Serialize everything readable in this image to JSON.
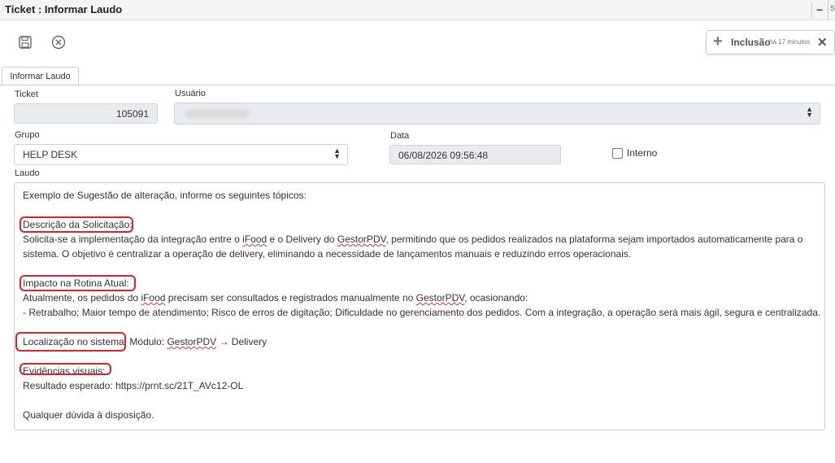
{
  "window": {
    "title": "Ticket : Informar Laudo",
    "minimize_label": "–",
    "edge_label": "S"
  },
  "toolbar": {
    "save_icon": "save-icon",
    "cancel_icon": "cancel-icon"
  },
  "notification": {
    "label": "Inclusão",
    "time": "há 17 minutos",
    "close": "✕",
    "plus": "+"
  },
  "tabs": [
    {
      "label": "Informar Laudo"
    }
  ],
  "form": {
    "ticket_label": "Ticket",
    "ticket_value": "105091",
    "usuario_label": "Usuário",
    "grupo_label": "Grupo",
    "grupo_value": "HELP DESK",
    "data_label": "Data",
    "data_value": "06/08/2026 09:56:48",
    "interno_label": "Interno",
    "interno_checked": false,
    "laudo_label": "Laudo"
  },
  "laudo": {
    "intro": "Exemplo de Sugestão de alteração, informe os seguintes tópicos:",
    "h1": "Descrição da Solicitação:",
    "p1a_1": "Solicita-se a implementação da integração entre o ",
    "p1a_ifood": "iFood",
    "p1a_2": " e o Delivery do ",
    "p1a_gestor": "GestorPDV",
    "p1a_3": ", permitindo que os pedidos realizados na plataforma sejam importados automaticamente para o",
    "p1b": "sistema. O objetivo é centralizar a operação de delivery, eliminando a necessidade de lançamentos manuais e reduzindo erros operacionais.",
    "h2": "Impacto na Rotina Atual:",
    "p2a_1": "Atualmente, os pedidos do ",
    "p2a_ifood": "iFood",
    "p2a_2": " precisam ser consultados e registrados manualmente no ",
    "p2a_gestor": "GestorPDV",
    "p2a_3": ", ocasionando:",
    "p2b": "- Retrabalho; Maior tempo de atendimento; Risco de erros de digitação; Dificuldade no gerenciamento dos pedidos. Com a integração, a operação será mais ágil, segura e centralizada.",
    "h3": "Localização no sistema:",
    "p3_1": " Módulo: ",
    "p3_gestor": "GestorPDV",
    "p3_2": " → Delivery",
    "h4": "Evidências visuais:",
    "p4": "Resultado esperado: https://prnt.sc/21T_AVc12-OL",
    "closing": "Qualquer dúvida à disposição."
  },
  "colors": {
    "highlight": "#e0202a",
    "field_bg": "#e9ecef"
  }
}
